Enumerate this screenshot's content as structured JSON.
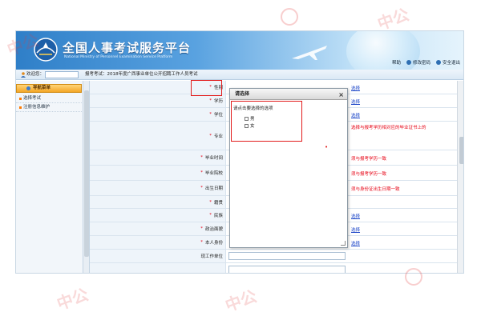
{
  "header": {
    "title": "全国人事考试服务平台",
    "subtitle": "National Ministry of Personnel Examination Service Platform",
    "links": [
      {
        "label": "帮助",
        "icon": "help-icon"
      },
      {
        "label": "修改密码",
        "icon": "key-icon"
      },
      {
        "label": "安全退出",
        "icon": "logout-icon"
      }
    ]
  },
  "infobar": {
    "welcome": "欢迎您：",
    "username": "",
    "breadcrumb": "报考考试：2018年度广西事业单位公开招聘工作人员考试"
  },
  "sidebar": {
    "header": "导航菜单",
    "items": [
      {
        "label": "选择考试"
      },
      {
        "label": "注册信息维护"
      }
    ]
  },
  "form": {
    "rows": [
      {
        "label": "性别",
        "required": true,
        "action": "选择",
        "hint": ""
      },
      {
        "label": "学历",
        "required": true,
        "action": "选择",
        "hint": ""
      },
      {
        "label": "学位",
        "required": true,
        "action": "选择",
        "hint": ""
      },
      {
        "label": "专业",
        "required": true,
        "action": "",
        "hint": "选择与报考学历相对应的毕业证书上的"
      },
      {
        "label": "毕业时间",
        "required": true,
        "action": "",
        "hint": "须与报考学历一致"
      },
      {
        "label": "毕业院校",
        "required": true,
        "action": "",
        "hint": "须与报考学历一致"
      },
      {
        "label": "出生日期",
        "required": true,
        "action": "",
        "hint": "须与身份证出生日期一致"
      },
      {
        "label": "籍贯",
        "required": true,
        "action": "",
        "hint": ""
      },
      {
        "label": "民族",
        "required": true,
        "action": "选择",
        "hint": ""
      },
      {
        "label": "政治面貌",
        "required": true,
        "action": "选择",
        "hint": ""
      },
      {
        "label": "本人身份",
        "required": true,
        "action": "选择",
        "hint": ""
      },
      {
        "label": "现工作单位",
        "required": false,
        "action": "",
        "hint": ""
      },
      {
        "label": "",
        "required": false,
        "action": "",
        "hint": ""
      }
    ]
  },
  "dialog": {
    "title": "请选择",
    "close": "×",
    "prompt": "请点击要选择的选项",
    "options": [
      {
        "label": "男"
      },
      {
        "label": "女"
      }
    ]
  },
  "watermark": {
    "text": "中公"
  },
  "colors": {
    "header_blue": "#2f7fc8",
    "required_red": "#e60012",
    "link_blue": "#1a44c7",
    "nav_orange": "#f4a626",
    "highlight_red": "#e21b1b"
  }
}
